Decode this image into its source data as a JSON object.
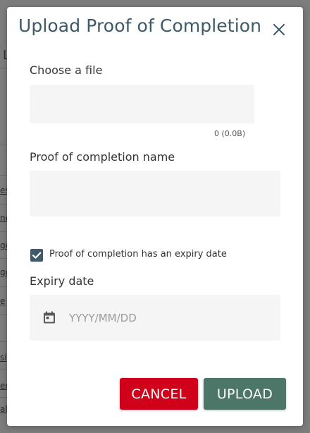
{
  "backdrop": {
    "heading_fragment": "L",
    "links": [
      "es",
      "ne",
      "ge",
      "ge",
      "e",
      "si",
      "en",
      "al"
    ]
  },
  "dialog": {
    "title": "Upload Proof of Completion",
    "close_icon": "close-icon",
    "file": {
      "label": "Choose a file",
      "size_text": "0 (0.0B)"
    },
    "name": {
      "label": "Proof of completion name",
      "value": ""
    },
    "expiry_checkbox": {
      "label": "Proof of completion has an expiry date",
      "checked": true
    },
    "expiry_date": {
      "label": "Expiry date",
      "placeholder": "YYYY/MM/DD",
      "icon": "calendar-icon"
    },
    "buttons": {
      "cancel": "CANCEL",
      "upload": "UPLOAD"
    }
  },
  "colors": {
    "title": "#3e5a68",
    "cancel": "#d0021b",
    "upload": "#4b7668",
    "checkbox": "#3f5a6a",
    "field_bg": "#f5f5f5"
  }
}
